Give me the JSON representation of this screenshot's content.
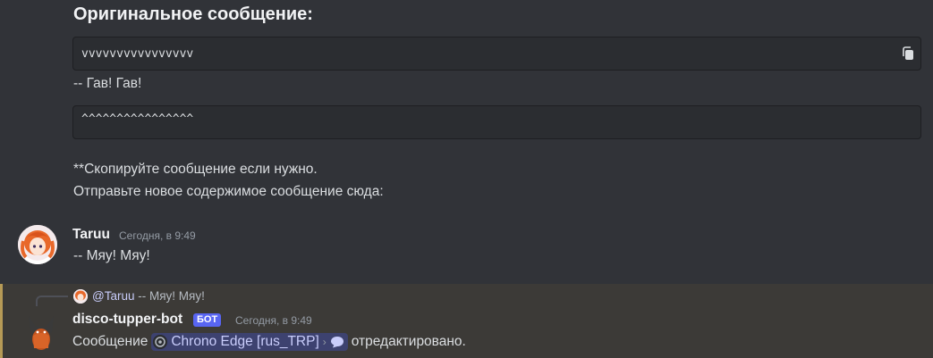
{
  "embed": {
    "heading": "Оригинальное сообщение:",
    "code_top": "vvvvvvvvvvvvvvvv",
    "quote": "-- Гав! Гав!",
    "code_bottom": "^^^^^^^^^^^^^^^^",
    "note_line1": "**Скопируйте сообщение если нужно.",
    "note_line2": "Отправьте новое содержимое сообщение сюда:"
  },
  "messages": [
    {
      "author": "Taruu",
      "timestamp": "Сегодня, в 9:49",
      "text": "-- Мяу! Мяу!"
    },
    {
      "reply": {
        "mention": "@Taruu",
        "text": "-- Мяу! Мяу!"
      },
      "author": "disco-tupper-bot",
      "badge": "БОТ",
      "timestamp": "Сегодня, в 9:49",
      "text_before": "Сообщение",
      "channel": "Chrono Edge [rus_TRP]",
      "chevron": "›",
      "text_after": "отредактировано."
    }
  ],
  "colors": {
    "background": "#313338",
    "highlight": "#3c3a37",
    "highlight_border": "#b69a56",
    "bot_badge": "#5865f2",
    "mention_chip": "#3d4270"
  },
  "icons": {
    "copy": "copy-icon",
    "thread": "speech-bubble-icon",
    "server": "server-icon"
  }
}
